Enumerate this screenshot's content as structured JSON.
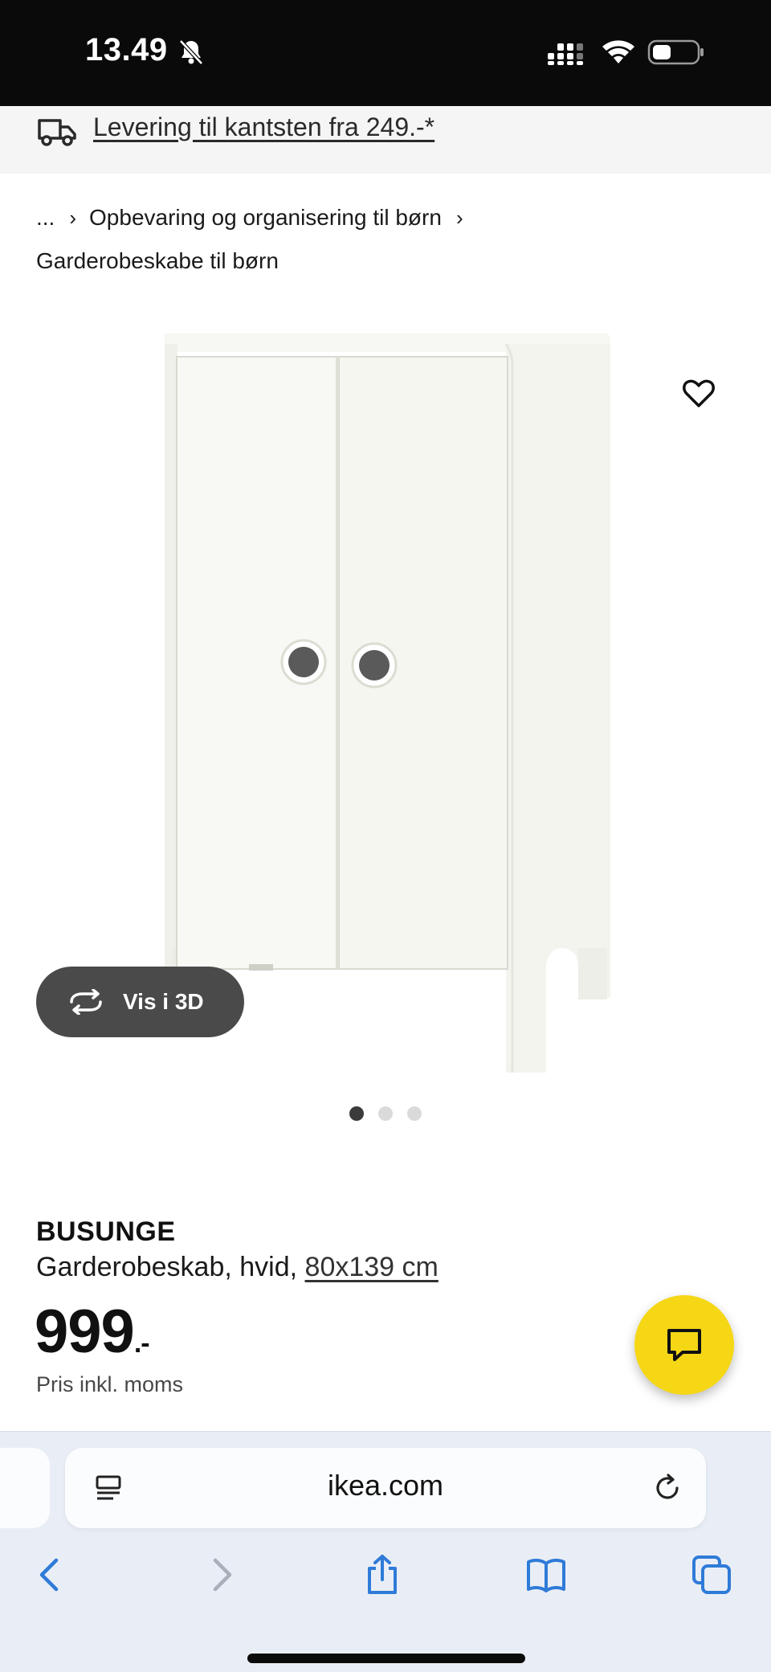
{
  "status_bar": {
    "time": "13.49",
    "icons": [
      "bell-slash-icon",
      "cellular-signal-icon",
      "wifi-icon",
      "battery-icon"
    ]
  },
  "delivery": {
    "icon": "truck-icon",
    "text": "Levering til kantsten fra 249.-*"
  },
  "breadcrumb": {
    "ellipsis": "...",
    "items": [
      "Opbevaring og organisering til børn",
      "Garderobeskabe til børn"
    ],
    "separator": "›"
  },
  "gallery": {
    "view3d_label": "Vis i 3D",
    "slide_count": 3,
    "active_slide": 1
  },
  "product": {
    "name": "BUSUNGE",
    "description": "Garderobeskab, hvid,",
    "size": "80x139 cm",
    "price": "999",
    "price_suffix": ".-",
    "price_note": "Pris inkl. moms"
  },
  "browser": {
    "url": "ikea.com"
  },
  "colors": {
    "accent_yellow": "#f5d716",
    "status_bar": "#0a0a0a",
    "browser_blue": "#2f7bd8"
  }
}
